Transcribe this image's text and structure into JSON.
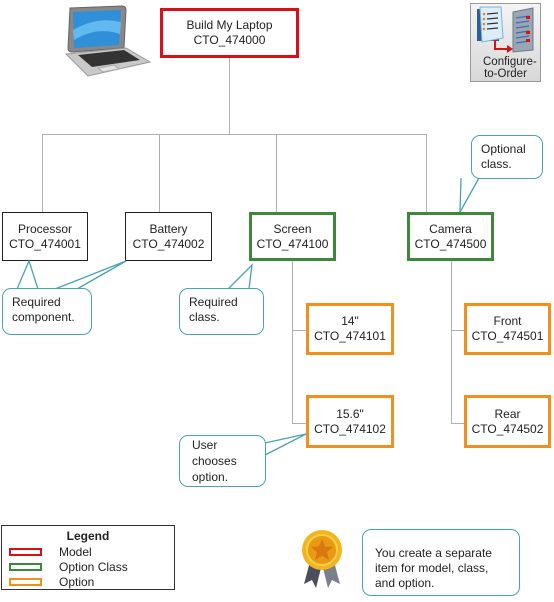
{
  "diagram": {
    "root": {
      "name": "Build My Laptop",
      "code": "CTO_474000",
      "type": "model"
    },
    "children": [
      {
        "name": "Processor",
        "code": "CTO_474001",
        "type": "component"
      },
      {
        "name": "Battery",
        "code": "CTO_474002",
        "type": "component"
      },
      {
        "name": "Screen",
        "code": "CTO_474100",
        "type": "option_class",
        "options": [
          {
            "name": "14\"",
            "code": "CTO_474101"
          },
          {
            "name": "15.6\"",
            "code": "CTO_474102"
          }
        ]
      },
      {
        "name": "Camera",
        "code": "CTO_474500",
        "type": "option_class",
        "options": [
          {
            "name": "Front",
            "code": "CTO_474501"
          },
          {
            "name": "Rear",
            "code": "CTO_474502"
          }
        ]
      }
    ]
  },
  "callouts": {
    "optional_class": "Optional class.",
    "required_component": "Required component.",
    "required_class": "Required class.",
    "user_chooses": "User chooses option.",
    "note": "You create a separate item for model, class, and option."
  },
  "badge": {
    "label": "Configure-to-Order"
  },
  "legend": {
    "title": "Legend",
    "items": [
      {
        "label": "Model",
        "color": "#d9101a"
      },
      {
        "label": "Option Class",
        "color": "#3a8a3a"
      },
      {
        "label": "Option",
        "color": "#f0901e"
      }
    ]
  },
  "colors": {
    "model": "#d9101a",
    "option_class": "#3a8a3a",
    "option": "#f0901e",
    "callout": "#4aa3b4"
  }
}
